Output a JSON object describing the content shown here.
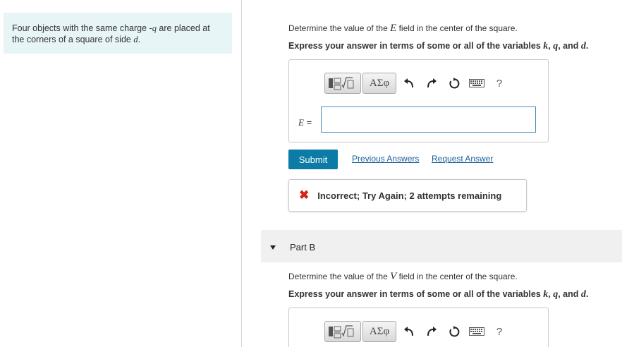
{
  "problem": {
    "text_1": "Four objects with the same charge -",
    "var_q": "q",
    "text_2": " are placed at the corners of a square of side ",
    "var_d": "d",
    "text_3": "."
  },
  "part_a": {
    "prompt_pre": "Determine the value of the ",
    "prompt_var": "E",
    "prompt_post": " field in the center of the square.",
    "instr_pre": "Express your answer in terms of some or all of the variables ",
    "instr_k": "k",
    "instr_sep1": ", ",
    "instr_q": "q",
    "instr_sep2": ", and ",
    "instr_d": "d",
    "instr_end": ".",
    "toolbar": {
      "greek": "ΑΣφ",
      "help": "?"
    },
    "eq_var": "E",
    "eq_sign": " =",
    "input_value": "",
    "submit_label": "Submit",
    "previous_answers_label": "Previous Answers",
    "request_answer_label": "Request Answer",
    "feedback_icon": "✖",
    "feedback_text": "Incorrect; Try Again; 2 attempts remaining"
  },
  "part_b": {
    "title": "Part B",
    "prompt_pre": "Determine the value of the ",
    "prompt_var": "V",
    "prompt_post": " field in the center of the square.",
    "instr_pre": "Express your answer in terms of some or all of the variables ",
    "instr_k": "k",
    "instr_sep1": ", ",
    "instr_q": "q",
    "instr_sep2": ", and ",
    "instr_d": "d",
    "instr_end": ".",
    "toolbar": {
      "greek": "ΑΣφ",
      "help": "?"
    }
  },
  "colors": {
    "problem_bg": "#e7f5f6",
    "submit_bg": "#0c7ba6",
    "link": "#1a5d96",
    "error": "#d4251b",
    "input_border": "#4a8cb8"
  },
  "icons": [
    "templates-icon",
    "undo-icon",
    "redo-icon",
    "reset-icon",
    "keyboard-icon",
    "help-icon",
    "error-x-icon",
    "caret-down-icon"
  ]
}
